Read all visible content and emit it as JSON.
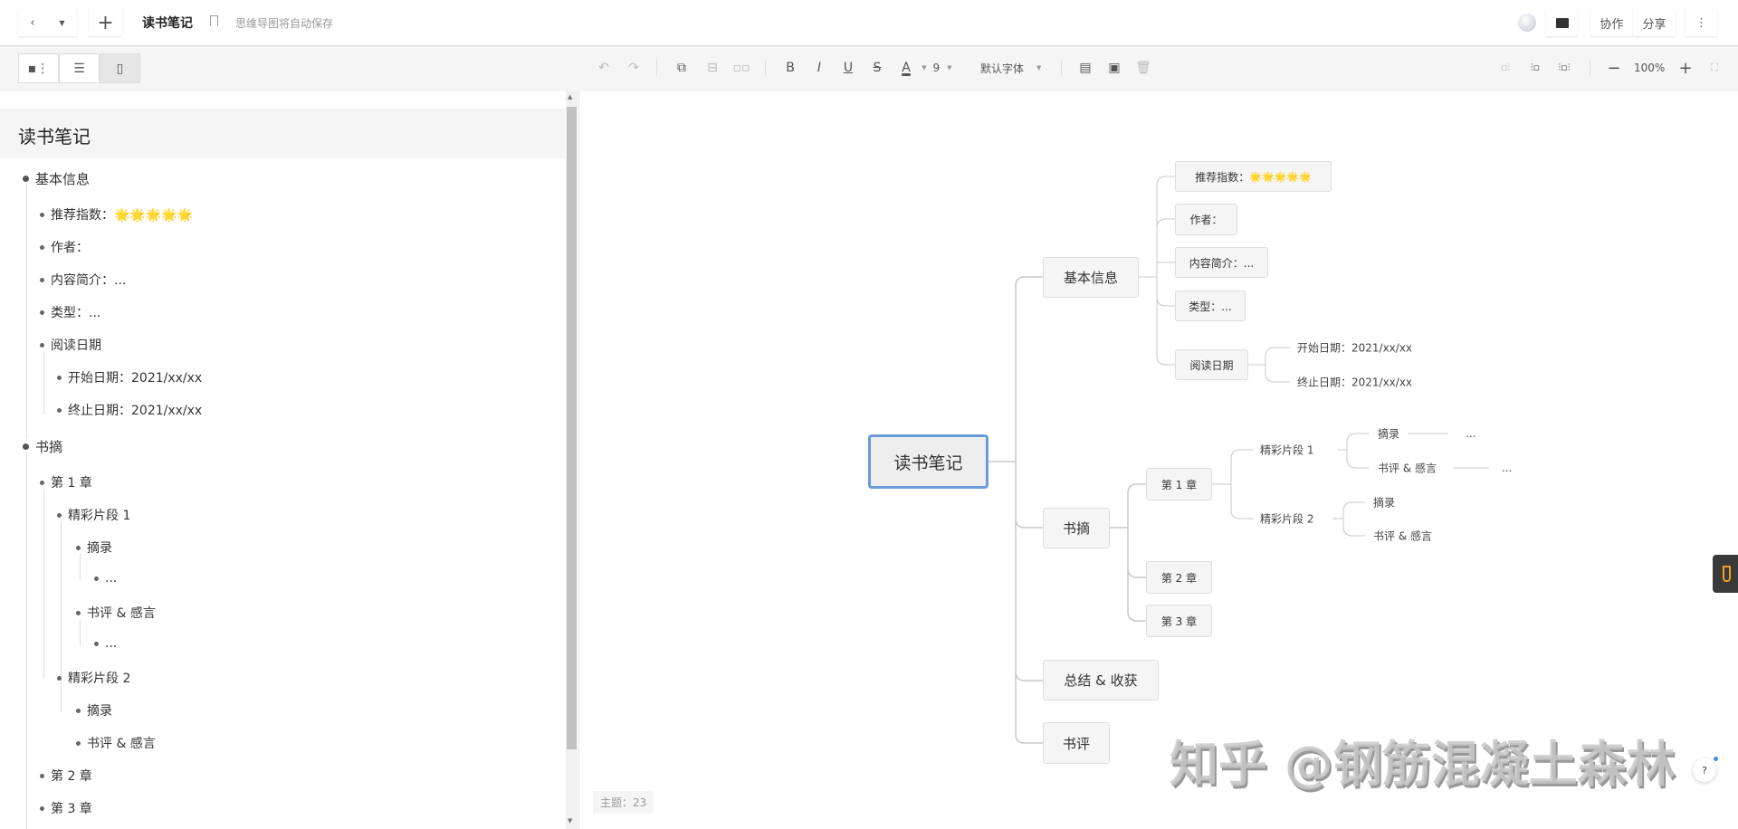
{
  "topbar": {
    "title": "读书笔记",
    "autosave": "思维导图将自动保存",
    "collab": "协作",
    "share": "分享"
  },
  "toolbar": {
    "font_size": "9",
    "font_family": "默认字体",
    "zoom": "100%",
    "bold": "B",
    "italic": "I",
    "underline": "U",
    "strike": "S",
    "color": "A"
  },
  "outline": {
    "title": "读书笔记",
    "items": [
      {
        "label": "基本信息",
        "level": 0
      },
      {
        "label": "推荐指数：🌟🌟🌟🌟🌟",
        "level": 1
      },
      {
        "label": "作者：",
        "level": 1
      },
      {
        "label": "内容简介：...",
        "level": 1
      },
      {
        "label": "类型：...",
        "level": 1
      },
      {
        "label": "阅读日期",
        "level": 1
      },
      {
        "label": "开始日期：2021/xx/xx",
        "level": 2
      },
      {
        "label": "终止日期：2021/xx/xx",
        "level": 2
      },
      {
        "label": "书摘",
        "level": 0
      },
      {
        "label": "第 1 章",
        "level": 1
      },
      {
        "label": "精彩片段 1",
        "level": 2
      },
      {
        "label": "摘录",
        "level": 3
      },
      {
        "label": "...",
        "level": 4
      },
      {
        "label": "书评 & 感言",
        "level": 3
      },
      {
        "label": "...",
        "level": 4
      },
      {
        "label": "精彩片段 2",
        "level": 2
      },
      {
        "label": "摘录",
        "level": 3
      },
      {
        "label": "书评 & 感言",
        "level": 3
      },
      {
        "label": "第 2 章",
        "level": 1
      },
      {
        "label": "第 3 章",
        "level": 1
      }
    ]
  },
  "mindmap": {
    "root": "读书笔记",
    "basic": "基本信息",
    "rating": "推荐指数：",
    "stars": "🌟🌟🌟🌟🌟",
    "author": "作者：",
    "intro": "内容简介：...",
    "type": "类型：...",
    "date": "阅读日期",
    "start": "开始日期：2021/xx/xx",
    "end": "终止日期：2021/xx/xx",
    "excerpt": "书摘",
    "ch1": "第 1 章",
    "ch2": "第 2 章",
    "ch3": "第 3 章",
    "seg1": "精彩片段 1",
    "seg2": "精彩片段 2",
    "quote": "摘录",
    "review": "书评 & 感言",
    "ellipsis": "...",
    "summary": "总结 & 收获",
    "bookreview": "书评"
  },
  "status": {
    "topics": "主题：23"
  },
  "watermark": "知乎 @钢筋混凝土森林",
  "colors": {
    "root_border": "#6a9bd8",
    "accent_dark": "#3a3a3a",
    "star": "#f2d600"
  }
}
